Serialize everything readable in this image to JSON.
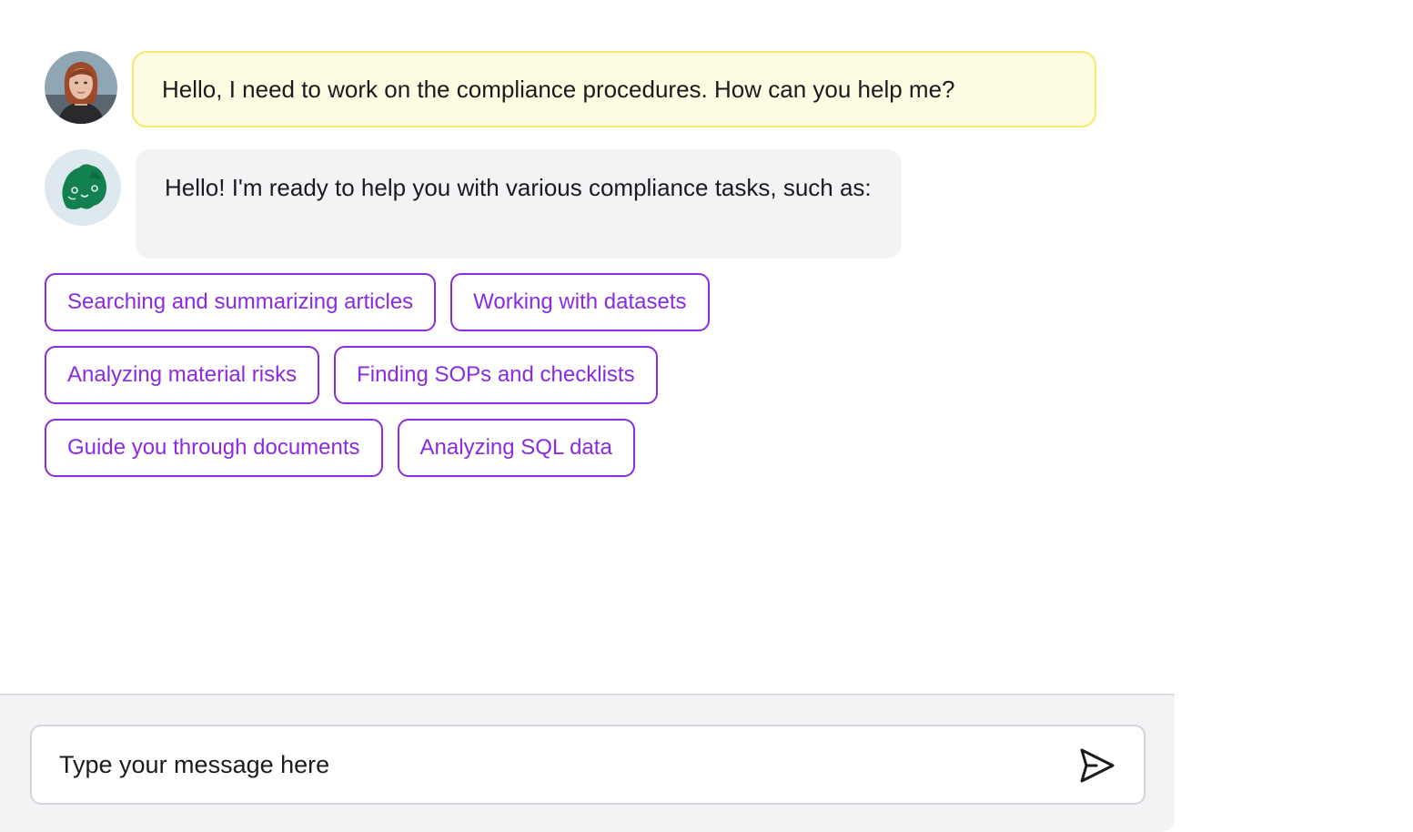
{
  "conversation": {
    "user_message": "Hello, I need to work on the compliance procedures. How can you help me?",
    "bot_message": "Hello! I'm ready to help you with various compliance tasks, such as:"
  },
  "avatars": {
    "user": "user-avatar-photo",
    "bot": "green-parrot-mascot-icon"
  },
  "suggestions": [
    [
      "Searching and summarizing articles",
      "Working with datasets"
    ],
    [
      "Analyzing material risks",
      "Finding SOPs and checklists"
    ],
    [
      "Guide you through documents",
      "Analyzing SQL data"
    ]
  ],
  "composer": {
    "placeholder": "Type your message here",
    "send_icon": "send-icon"
  },
  "colors": {
    "accent": "#8a2be2",
    "user_bubble_bg": "#fdfbe1",
    "user_bubble_border": "#f5ea6a",
    "bot_bubble_bg": "#f2f3f5",
    "bot_avatar_bg": "#dde8ef",
    "bot_mascot": "#13804f"
  }
}
